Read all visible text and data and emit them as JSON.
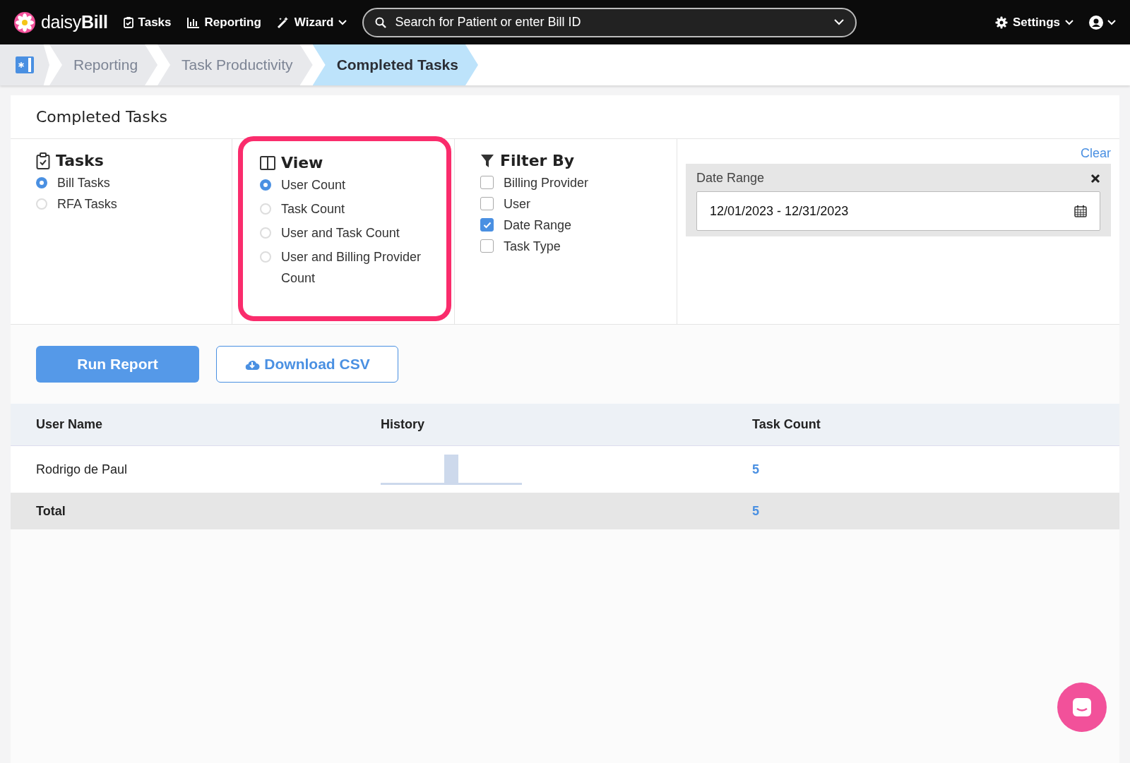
{
  "navbar": {
    "logo": "daisy",
    "logo_bold": "Bill",
    "links": [
      {
        "kind": "tasks",
        "label": "Tasks",
        "caret": false
      },
      {
        "kind": "reporting",
        "label": "Reporting",
        "caret": false
      },
      {
        "kind": "wizard",
        "label": "Wizard",
        "caret": true
      }
    ],
    "search": {
      "placeholder": "Search for Patient or enter Bill ID"
    },
    "settings": "Settings"
  },
  "breadcrumb": [
    {
      "label": "Reporting",
      "selected": false
    },
    {
      "label": "Task Productivity",
      "selected": false
    },
    {
      "label": "Completed Tasks",
      "selected": true
    }
  ],
  "page_title": "Completed Tasks",
  "tasks": {
    "title": "Tasks",
    "options": [
      {
        "label": "Bill Tasks",
        "selected": true
      },
      {
        "label": "RFA Tasks",
        "selected": false
      }
    ]
  },
  "view": {
    "title": "View",
    "highlighted": true,
    "options": [
      {
        "label": "User Count",
        "selected": true
      },
      {
        "label": "Task Count",
        "selected": false
      },
      {
        "label": "User and Task Count",
        "selected": false
      },
      {
        "label": "User and Billing Provider Count",
        "selected": false
      }
    ]
  },
  "filter_by": {
    "title": "Filter By",
    "options": [
      {
        "label": "Billing Provider",
        "checked": false
      },
      {
        "label": "User",
        "checked": false
      },
      {
        "label": "Date Range",
        "checked": true
      },
      {
        "label": "Task Type",
        "checked": false
      }
    ]
  },
  "clear": "Clear",
  "date_range": {
    "label": "Date Range",
    "value": "12/01/2023 - 12/31/2023"
  },
  "buttons": {
    "run": "Run Report",
    "download": "Download CSV"
  },
  "table": {
    "columns": [
      "User Name",
      "History",
      "Task Count"
    ],
    "rows": [
      {
        "user": "Rodrigo de Paul",
        "count": "5"
      }
    ],
    "total": {
      "label": "Total",
      "count": "5"
    }
  }
}
